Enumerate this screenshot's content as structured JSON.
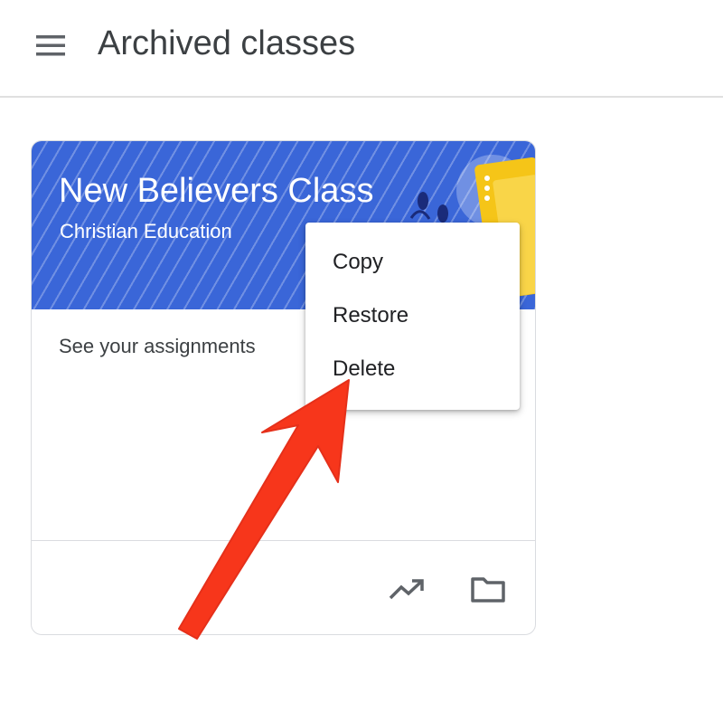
{
  "header": {
    "title": "Archived classes",
    "menu_icon": "hamburger-menu-icon"
  },
  "class_card": {
    "name": "New Believers Class",
    "section": "Christian Education",
    "banner_color": "#3a66d8",
    "assignments_link": "See your assignments",
    "more_icon": "more-vert-icon",
    "footer_icons": [
      "trending-up-icon",
      "folder-icon"
    ]
  },
  "context_menu": {
    "items": [
      {
        "label": "Copy"
      },
      {
        "label": "Restore"
      },
      {
        "label": "Delete"
      }
    ]
  },
  "annotation": {
    "arrow_color": "#f7361b",
    "points_to": "Delete"
  }
}
